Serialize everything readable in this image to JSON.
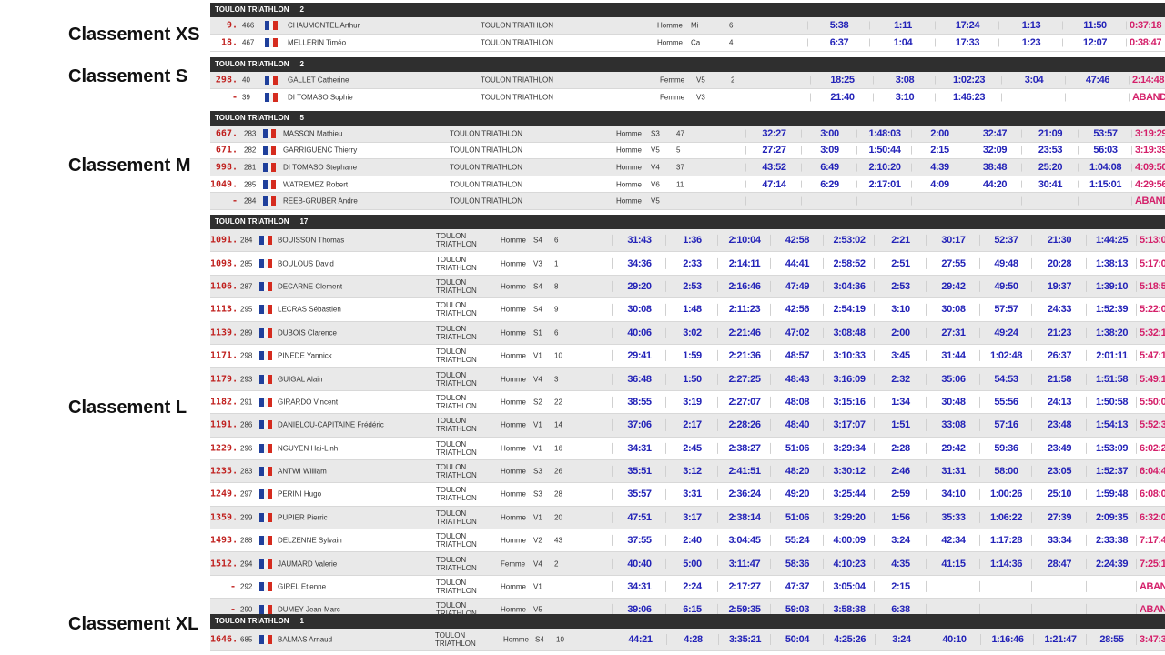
{
  "labels": {
    "xs": "Classement XS",
    "s": "Classement S",
    "m": "Classement M",
    "l": "Classement L",
    "xl": "Classement XL"
  },
  "colors": {
    "header": "#2f2f2f",
    "rank": "#c0211f",
    "time": "#2323b8",
    "total": "#d4206a"
  },
  "xs": {
    "header": "TOULON TRIATHLON",
    "count": "2",
    "rows": [
      [
        "9.",
        "466",
        "CHAUMONTEL Arthur",
        "TOULON TRIATHLON",
        "Homme",
        "Mi",
        "6",
        "5:38",
        "1:11",
        "17:24",
        "1:13",
        "11:50",
        "0:37:18"
      ],
      [
        "18.",
        "467",
        "MELLERIN Timéo",
        "TOULON TRIATHLON",
        "Homme",
        "Ca",
        "4",
        "6:37",
        "1:04",
        "17:33",
        "1:23",
        "12:07",
        "0:38:47"
      ]
    ]
  },
  "s": {
    "header": "TOULON TRIATHLON",
    "count": "2",
    "rows": [
      [
        "298.",
        "40",
        "GALLET Catherine",
        "TOULON TRIATHLON",
        "Femme",
        "V5",
        "2",
        "18:25",
        "3:08",
        "1:02:23",
        "3:04",
        "47:46",
        "2:14:48"
      ],
      [
        "-",
        "39",
        "DI TOMASO Sophie",
        "TOULON TRIATHLON",
        "Femme",
        "V3",
        "",
        "21:40",
        "3:10",
        "1:46:23",
        "",
        "",
        "ABANDON"
      ]
    ]
  },
  "m": {
    "header": "TOULON TRIATHLON",
    "count": "5",
    "rows": [
      [
        "667.",
        "283",
        "MASSON Mathieu",
        "TOULON TRIATHLON",
        "Homme",
        "S3",
        "47",
        "32:27",
        "3:00",
        "1:48:03",
        "2:00",
        "32:47",
        "21:09",
        "53:57",
        "3:19:29"
      ],
      [
        "671.",
        "282",
        "GARRIGUENC Thierry",
        "TOULON TRIATHLON",
        "Homme",
        "V5",
        "5",
        "27:27",
        "3:09",
        "1:50:44",
        "2:15",
        "32:09",
        "23:53",
        "56:03",
        "3:19:39"
      ],
      [
        "998.",
        "281",
        "DI TOMASO Stephane",
        "TOULON TRIATHLON",
        "Homme",
        "V4",
        "37",
        "43:52",
        "6:49",
        "2:10:20",
        "4:39",
        "38:48",
        "25:20",
        "1:04:08",
        "4:09:50"
      ],
      [
        "1049.",
        "285",
        "WATREMEZ Robert",
        "TOULON TRIATHLON",
        "Homme",
        "V6",
        "11",
        "47:14",
        "6:29",
        "2:17:01",
        "4:09",
        "44:20",
        "30:41",
        "1:15:01",
        "4:29:56"
      ],
      [
        "-",
        "284",
        "REEB-GRUBER Andre",
        "TOULON TRIATHLON",
        "Homme",
        "V5",
        "",
        "",
        "",
        "",
        "",
        "",
        "",
        "",
        "ABANDON"
      ]
    ]
  },
  "l": {
    "header": "TOULON TRIATHLON",
    "count": "17",
    "rows": [
      [
        "1091.",
        "284",
        "BOUISSON Thomas",
        "TOULON TRIATHLON",
        "Homme",
        "S4",
        "6",
        "31:43",
        "1:36",
        "2:10:04",
        "42:58",
        "2:53:02",
        "2:21",
        "30:17",
        "52:37",
        "21:30",
        "1:44:25",
        "5:13:09"
      ],
      [
        "1098.",
        "285",
        "BOULOUS David",
        "TOULON TRIATHLON",
        "Homme",
        "V3",
        "1",
        "34:36",
        "2:33",
        "2:14:11",
        "44:41",
        "2:58:52",
        "2:51",
        "27:55",
        "49:48",
        "20:28",
        "1:38:13",
        "5:17:07"
      ],
      [
        "1106.",
        "287",
        "DECARNE Clement",
        "TOULON TRIATHLON",
        "Homme",
        "S4",
        "8",
        "29:20",
        "2:53",
        "2:16:46",
        "47:49",
        "3:04:36",
        "2:53",
        "29:42",
        "49:50",
        "19:37",
        "1:39:10",
        "5:18:55"
      ],
      [
        "1113.",
        "295",
        "LECRAS Sébastien",
        "TOULON TRIATHLON",
        "Homme",
        "S4",
        "9",
        "30:08",
        "1:48",
        "2:11:23",
        "42:56",
        "2:54:19",
        "3:10",
        "30:08",
        "57:57",
        "24:33",
        "1:52:39",
        "5:22:06"
      ],
      [
        "1139.",
        "289",
        "DUBOIS Clarence",
        "TOULON TRIATHLON",
        "Homme",
        "S1",
        "6",
        "40:06",
        "3:02",
        "2:21:46",
        "47:02",
        "3:08:48",
        "2:00",
        "27:31",
        "49:24",
        "21:23",
        "1:38:20",
        "5:32:18"
      ],
      [
        "1171.",
        "298",
        "PINEDE Yannick",
        "TOULON TRIATHLON",
        "Homme",
        "V1",
        "10",
        "29:41",
        "1:59",
        "2:21:36",
        "48:57",
        "3:10:33",
        "3:45",
        "31:44",
        "1:02:48",
        "26:37",
        "2:01:11",
        "5:47:10"
      ],
      [
        "1179.",
        "293",
        "GUIGAL Alain",
        "TOULON TRIATHLON",
        "Homme",
        "V4",
        "3",
        "36:48",
        "1:50",
        "2:27:25",
        "48:43",
        "3:16:09",
        "2:32",
        "35:06",
        "54:53",
        "21:58",
        "1:51:58",
        "5:49:19"
      ],
      [
        "1182.",
        "291",
        "GIRARDO Vincent",
        "TOULON TRIATHLON",
        "Homme",
        "S2",
        "22",
        "38:55",
        "3:19",
        "2:27:07",
        "48:08",
        "3:15:16",
        "1:34",
        "30:48",
        "55:56",
        "24:13",
        "1:50:58",
        "5:50:05"
      ],
      [
        "1191.",
        "286",
        "DANIELOU-CAPITAINE Frédéric",
        "TOULON TRIATHLON",
        "Homme",
        "V1",
        "14",
        "37:06",
        "2:17",
        "2:28:26",
        "48:40",
        "3:17:07",
        "1:51",
        "33:08",
        "57:16",
        "23:48",
        "1:54:13",
        "5:52:36"
      ],
      [
        "1229.",
        "296",
        "NGUYEN Hai-Linh",
        "TOULON TRIATHLON",
        "Homme",
        "V1",
        "16",
        "34:31",
        "2:45",
        "2:38:27",
        "51:06",
        "3:29:34",
        "2:28",
        "29:42",
        "59:36",
        "23:49",
        "1:53:09",
        "6:02:28"
      ],
      [
        "1235.",
        "283",
        "ANTWI William",
        "TOULON TRIATHLON",
        "Homme",
        "S3",
        "26",
        "35:51",
        "3:12",
        "2:41:51",
        "48:20",
        "3:30:12",
        "2:46",
        "31:31",
        "58:00",
        "23:05",
        "1:52:37",
        "6:04:40"
      ],
      [
        "1249.",
        "297",
        "PERINI Hugo",
        "TOULON TRIATHLON",
        "Homme",
        "S3",
        "28",
        "35:57",
        "3:31",
        "2:36:24",
        "49:20",
        "3:25:44",
        "2:59",
        "34:10",
        "1:00:26",
        "25:10",
        "1:59:48",
        "6:08:02"
      ],
      [
        "1359.",
        "299",
        "PUPIER Pierric",
        "TOULON TRIATHLON",
        "Homme",
        "V1",
        "20",
        "47:51",
        "3:17",
        "2:38:14",
        "51:06",
        "3:29:20",
        "1:56",
        "35:33",
        "1:06:22",
        "27:39",
        "2:09:35",
        "6:32:02"
      ],
      [
        "1493.",
        "288",
        "DELZENNE Sylvain",
        "TOULON TRIATHLON",
        "Homme",
        "V2",
        "43",
        "37:55",
        "2:40",
        "3:04:45",
        "55:24",
        "4:00:09",
        "3:24",
        "42:34",
        "1:17:28",
        "33:34",
        "2:33:38",
        "7:17:48"
      ],
      [
        "1512.",
        "294",
        "JAUMARD Valerie",
        "TOULON TRIATHLON",
        "Femme",
        "V4",
        "2",
        "40:40",
        "5:00",
        "3:11:47",
        "58:36",
        "4:10:23",
        "4:35",
        "41:15",
        "1:14:36",
        "28:47",
        "2:24:39",
        "7:25:19"
      ],
      [
        "-",
        "292",
        "GIREL Etienne",
        "TOULON TRIATHLON",
        "Homme",
        "V1",
        "",
        "34:31",
        "2:24",
        "2:17:27",
        "47:37",
        "3:05:04",
        "2:15",
        "",
        "",
        "",
        "",
        "ABANDON"
      ],
      [
        "-",
        "290",
        "DUMEY Jean-Marc",
        "TOULON TRIATHLON",
        "Homme",
        "V5",
        "",
        "39:06",
        "6:15",
        "2:59:35",
        "59:03",
        "3:58:38",
        "6:38",
        "",
        "",
        "",
        "",
        "ABANDON"
      ]
    ]
  },
  "xl": {
    "header": "TOULON TRIATHLON",
    "count": "1",
    "rows": [
      [
        "1646.",
        "685",
        "BALMAS Arnaud",
        "TOULON TRIATHLON",
        "Homme",
        "S4",
        "10",
        "44:21",
        "4:28",
        "3:35:21",
        "50:04",
        "4:25:26",
        "3:24",
        "40:10",
        "1:16:46",
        "1:21:47",
        "28:55",
        "3:47:39"
      ]
    ]
  }
}
